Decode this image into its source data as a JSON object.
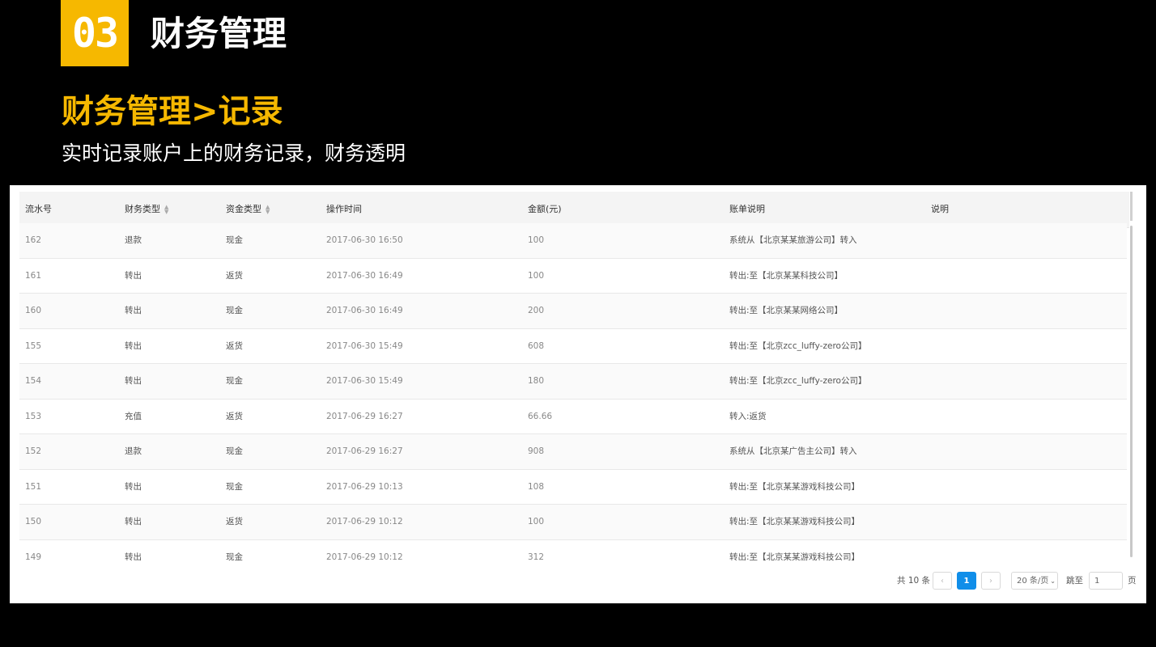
{
  "header": {
    "badge_number": "03",
    "section_title": "财务管理",
    "subtitle": "财务管理>记录",
    "description": "实时记录账户上的财务记录，财务透明"
  },
  "table": {
    "columns": [
      "流水号",
      "财务类型",
      "资金类型",
      "操作时间",
      "金额(元)",
      "账单说明",
      "说明"
    ],
    "sortable_columns": [
      "财务类型",
      "资金类型"
    ],
    "rows": [
      {
        "id": "162",
        "type": "退款",
        "fund": "现金",
        "time": "2017-06-30 16:50",
        "amount": "100",
        "bill": "系统从【北京某某旅游公司】转入",
        "note": ""
      },
      {
        "id": "161",
        "type": "转出",
        "fund": "返货",
        "time": "2017-06-30 16:49",
        "amount": "100",
        "bill": "转出:至【北京某某科技公司】",
        "note": ""
      },
      {
        "id": "160",
        "type": "转出",
        "fund": "现金",
        "time": "2017-06-30 16:49",
        "amount": "200",
        "bill": "转出:至【北京某某网络公司】",
        "note": ""
      },
      {
        "id": "155",
        "type": "转出",
        "fund": "返货",
        "time": "2017-06-30 15:49",
        "amount": "608",
        "bill": "转出:至【北京zcc_luffy-zero公司】",
        "note": ""
      },
      {
        "id": "154",
        "type": "转出",
        "fund": "现金",
        "time": "2017-06-30 15:49",
        "amount": "180",
        "bill": "转出:至【北京zcc_luffy-zero公司】",
        "note": ""
      },
      {
        "id": "153",
        "type": "充值",
        "fund": "返货",
        "time": "2017-06-29 16:27",
        "amount": "66.66",
        "bill": "转入:返货",
        "note": ""
      },
      {
        "id": "152",
        "type": "退款",
        "fund": "现金",
        "time": "2017-06-29 16:27",
        "amount": "908",
        "bill": "系统从【北京某广告主公司】转入",
        "note": ""
      },
      {
        "id": "151",
        "type": "转出",
        "fund": "现金",
        "time": "2017-06-29 10:13",
        "amount": "108",
        "bill": "转出:至【北京某某游戏科技公司】",
        "note": ""
      },
      {
        "id": "150",
        "type": "转出",
        "fund": "返货",
        "time": "2017-06-29 10:12",
        "amount": "100",
        "bill": "转出:至【北京某某游戏科技公司】",
        "note": ""
      },
      {
        "id": "149",
        "type": "转出",
        "fund": "现金",
        "time": "2017-06-29 10:12",
        "amount": "312",
        "bill": "转出:至【北京某某游戏科技公司】",
        "note": ""
      }
    ]
  },
  "pagination": {
    "total_label": "共 10 条",
    "prev_icon": "‹",
    "next_icon": "›",
    "current_page": "1",
    "page_size_label": "20 条/页",
    "jump_label": "跳至",
    "jump_value": "1",
    "page_suffix": "页"
  },
  "colors": {
    "accent": "#f6b800",
    "page_active": "#108ee9"
  }
}
